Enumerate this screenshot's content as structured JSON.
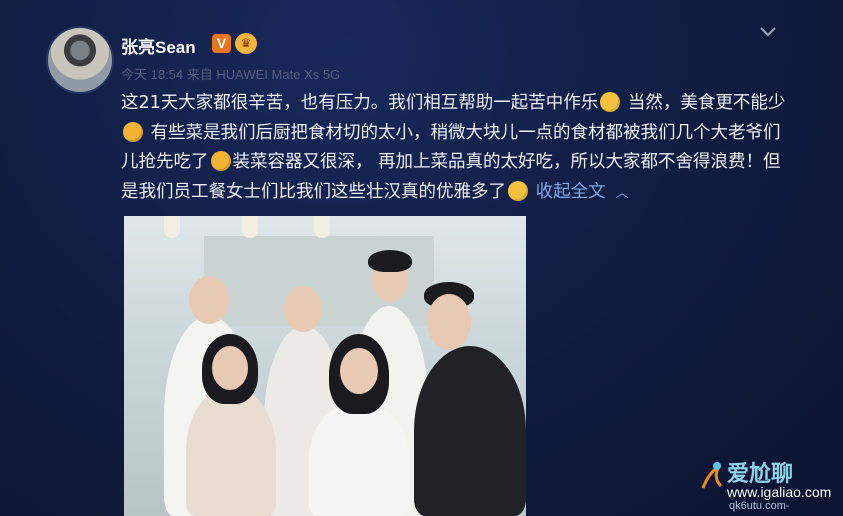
{
  "post": {
    "username": "张亮Sean",
    "verified_badge": "V",
    "timestamp": "今天 18:54",
    "source": "来自 HUAWEI Mate Xs 5G",
    "text": {
      "p1": "这21天大家都很辛苦，也有压力。我们相互帮助一起苦中作乐",
      "p2": " 当然，美食更不能少",
      "p3": " 有些菜是我们后厨把食材切的太小，稍微大块儿一点的食材都被我们几个大老爷们儿抢先吃了",
      "p4": "装菜容器又很深， 再加上菜品真的太好吃，所以大家都不舍得浪费！但是我们员工餐女士们比我们这些壮汉真的优雅多了"
    },
    "collapse_label": "收起全文",
    "collapse_icon": "chevron-up-icon",
    "menu_icon": "chevron-down-icon"
  },
  "watermark": {
    "title": "爱尬聊",
    "url": "www.igaliao.com",
    "sub": "qk6utu.com-"
  },
  "colors": {
    "background": "#0f1b3d",
    "text": "#edf0f7",
    "meta": "#56607d",
    "link": "#7fa7e6",
    "badge_orange": "#e9761d"
  }
}
